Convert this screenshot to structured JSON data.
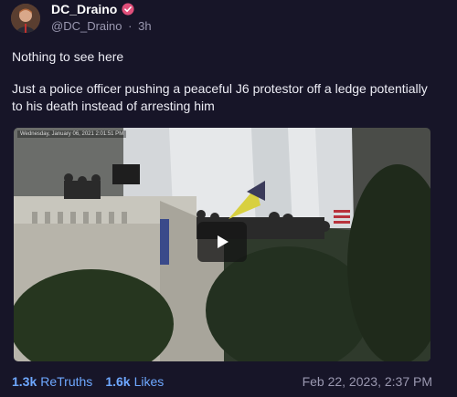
{
  "author": {
    "display_name": "DC_Draino",
    "handle": "@DC_Draino",
    "age": "3h",
    "separator": "·",
    "verified_icon": "verified-badge-icon",
    "accent_color": "#e04f7a"
  },
  "post": {
    "line1": "Nothing to see here",
    "line2": "Just a police officer pushing a peaceful J6 protestor off a ledge potentially to his death instead of arresting him"
  },
  "media": {
    "overlay_timestamp": "Wednesday, January 06, 2021 2:01:51 PM",
    "play_icon": "play-icon"
  },
  "stats": {
    "retruths_count": "1.3k",
    "retruths_label": "ReTruths",
    "likes_count": "1.6k",
    "likes_label": "Likes",
    "date": "Feb 22, 2023, 2:37 PM",
    "link_color": "#6ea8ff"
  }
}
